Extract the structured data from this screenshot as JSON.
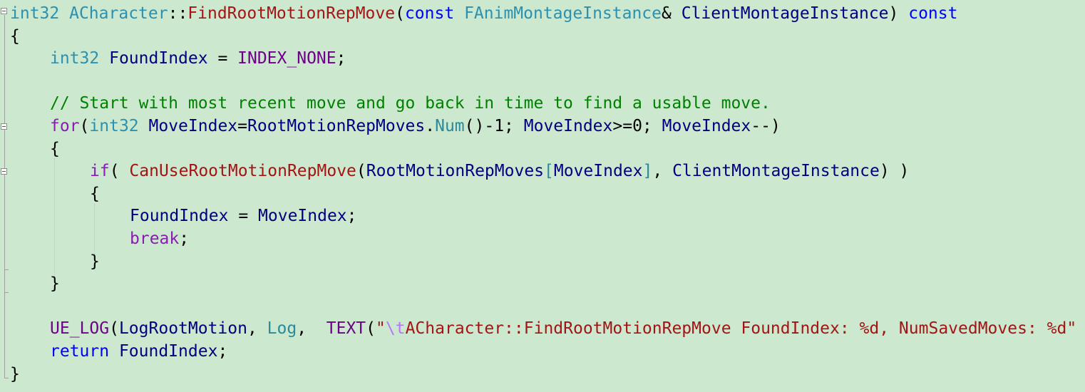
{
  "editor": {
    "background": "#cce8cf",
    "lines": [
      {
        "indent": 0,
        "tokens": [
          {
            "t": "int32",
            "c": "type"
          },
          {
            "t": " ",
            "c": "plain"
          },
          {
            "t": "ACharacter",
            "c": "type"
          },
          {
            "t": "::",
            "c": "plain"
          },
          {
            "t": "FindRootMotionRepMove",
            "c": "fn"
          },
          {
            "t": "(",
            "c": "plain"
          },
          {
            "t": "const",
            "c": "kw"
          },
          {
            "t": " ",
            "c": "plain"
          },
          {
            "t": "FAnimMontageInstance",
            "c": "type"
          },
          {
            "t": "& ",
            "c": "plain"
          },
          {
            "t": "ClientMontageInstance",
            "c": "id"
          },
          {
            "t": ") ",
            "c": "plain"
          },
          {
            "t": "const",
            "c": "kw"
          }
        ]
      },
      {
        "indent": 0,
        "tokens": [
          {
            "t": "{",
            "c": "plain"
          }
        ]
      },
      {
        "indent": 1,
        "tokens": [
          {
            "t": "int32",
            "c": "type"
          },
          {
            "t": " ",
            "c": "plain"
          },
          {
            "t": "FoundIndex",
            "c": "id"
          },
          {
            "t": " = ",
            "c": "plain"
          },
          {
            "t": "INDEX_NONE",
            "c": "macro"
          },
          {
            "t": ";",
            "c": "plain"
          }
        ]
      },
      {
        "indent": 1,
        "tokens": []
      },
      {
        "indent": 1,
        "tokens": [
          {
            "t": "// Start with most recent move and go back in time to find a usable move.",
            "c": "cmt"
          }
        ]
      },
      {
        "indent": 1,
        "tokens": [
          {
            "t": "for",
            "c": "kw2"
          },
          {
            "t": "(",
            "c": "plain"
          },
          {
            "t": "int32",
            "c": "type"
          },
          {
            "t": " ",
            "c": "plain"
          },
          {
            "t": "MoveIndex",
            "c": "id"
          },
          {
            "t": "=",
            "c": "plain"
          },
          {
            "t": "RootMotionRepMoves",
            "c": "id"
          },
          {
            "t": ".",
            "c": "plain"
          },
          {
            "t": "Num",
            "c": "ty2"
          },
          {
            "t": "()-1; ",
            "c": "plain"
          },
          {
            "t": "MoveIndex",
            "c": "id"
          },
          {
            "t": ">=0; ",
            "c": "plain"
          },
          {
            "t": "MoveIndex",
            "c": "id"
          },
          {
            "t": "--)",
            "c": "plain"
          }
        ]
      },
      {
        "indent": 1,
        "tokens": [
          {
            "t": "{",
            "c": "plain"
          }
        ]
      },
      {
        "indent": 2,
        "tokens": [
          {
            "t": "if",
            "c": "kw2"
          },
          {
            "t": "( ",
            "c": "plain"
          },
          {
            "t": "CanUseRootMotionRepMove",
            "c": "fn"
          },
          {
            "t": "(",
            "c": "plain"
          },
          {
            "t": "RootMotionRepMoves",
            "c": "id"
          },
          {
            "t": "[",
            "c": "ty2"
          },
          {
            "t": "MoveIndex",
            "c": "id"
          },
          {
            "t": "]",
            "c": "ty2"
          },
          {
            "t": ", ",
            "c": "plain"
          },
          {
            "t": "ClientMontageInstance",
            "c": "id"
          },
          {
            "t": ") )",
            "c": "plain"
          }
        ]
      },
      {
        "indent": 2,
        "tokens": [
          {
            "t": "{",
            "c": "plain"
          }
        ]
      },
      {
        "indent": 3,
        "tokens": [
          {
            "t": "FoundIndex",
            "c": "id"
          },
          {
            "t": " = ",
            "c": "plain"
          },
          {
            "t": "MoveIndex",
            "c": "id"
          },
          {
            "t": ";",
            "c": "plain"
          }
        ]
      },
      {
        "indent": 3,
        "tokens": [
          {
            "t": "break",
            "c": "kw2"
          },
          {
            "t": ";",
            "c": "plain"
          }
        ]
      },
      {
        "indent": 2,
        "tokens": [
          {
            "t": "}",
            "c": "plain"
          }
        ]
      },
      {
        "indent": 1,
        "tokens": [
          {
            "t": "}",
            "c": "plain"
          }
        ]
      },
      {
        "indent": 1,
        "tokens": []
      },
      {
        "indent": 1,
        "tokens": [
          {
            "t": "UE_LOG",
            "c": "macro"
          },
          {
            "t": "(",
            "c": "plain"
          },
          {
            "t": "LogRootMotion",
            "c": "id"
          },
          {
            "t": ", ",
            "c": "plain"
          },
          {
            "t": "Log",
            "c": "ty2"
          },
          {
            "t": ",  ",
            "c": "plain"
          },
          {
            "t": "TEXT",
            "c": "macro"
          },
          {
            "t": "(",
            "c": "plain"
          },
          {
            "t": "\"",
            "c": "str"
          },
          {
            "t": "\\t",
            "c": "esc"
          },
          {
            "t": "ACharacter::FindRootMotionRepMove FoundIndex: %d, NumSavedMoves: %d\"",
            "c": "str"
          }
        ]
      },
      {
        "indent": 1,
        "tokens": [
          {
            "t": "return",
            "c": "kw"
          },
          {
            "t": " ",
            "c": "plain"
          },
          {
            "t": "FoundIndex",
            "c": "id"
          },
          {
            "t": ";",
            "c": "plain"
          }
        ]
      },
      {
        "indent": 0,
        "tokens": [
          {
            "t": "}",
            "c": "plain"
          }
        ]
      }
    ]
  }
}
